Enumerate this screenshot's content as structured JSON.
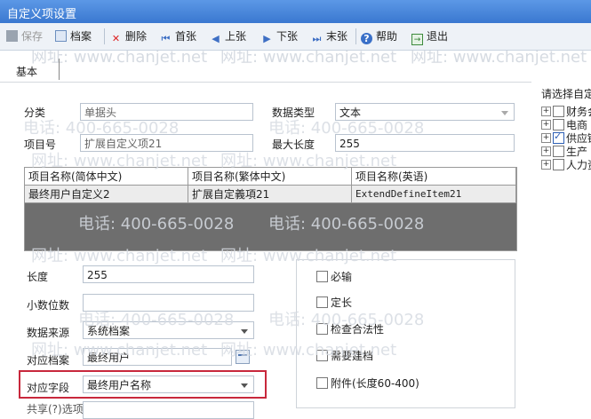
{
  "window": {
    "title": "自定义项设置"
  },
  "toolbar": {
    "save": "保存",
    "archive": "档案",
    "delete": "删除",
    "first": "首张",
    "prev": "上张",
    "next": "下张",
    "last": "末张",
    "help": "帮助",
    "exit": "退出"
  },
  "tab": {
    "basic": "基本"
  },
  "form": {
    "category_label": "分类",
    "category_value": "单据头",
    "datatype_label": "数据类型",
    "datatype_value": "文本",
    "itemno_label": "项目号",
    "itemno_value": "扩展自定义项21",
    "maxlen_label": "最大长度",
    "maxlen_value": "255"
  },
  "grid": {
    "headers": [
      "项目名称(简体中文)",
      "项目名称(繁体中文)",
      "项目名称(英语)"
    ],
    "row": [
      "最终用户自定义2",
      "扩展自定義項21",
      "ExtendDefineItem21"
    ]
  },
  "props": {
    "length_label": "长度",
    "length_value": "255",
    "decimals_label": "小数位数",
    "decimals_value": "",
    "source_label": "数据来源",
    "source_value": "系统档案",
    "archive_label": "对应档案",
    "archive_value": "最终用户",
    "field_label": "对应字段",
    "field_value": "最终用户名称",
    "partial_label": "共享(?)选项"
  },
  "checks": {
    "required": "必输",
    "fixed_len": "定长",
    "validate": "检查合法性",
    "need_archive": "需要建档",
    "attachment": "附件(长度60-400)"
  },
  "side": {
    "heading": "请选择自定",
    "items": [
      "财务会",
      "电商",
      "供应链",
      "生产",
      "人力资"
    ],
    "checked": [
      false,
      false,
      true,
      false,
      false
    ]
  },
  "watermark": {
    "phone": "电话: 400-665-0028",
    "site": "网址: www.chanjet.net"
  }
}
